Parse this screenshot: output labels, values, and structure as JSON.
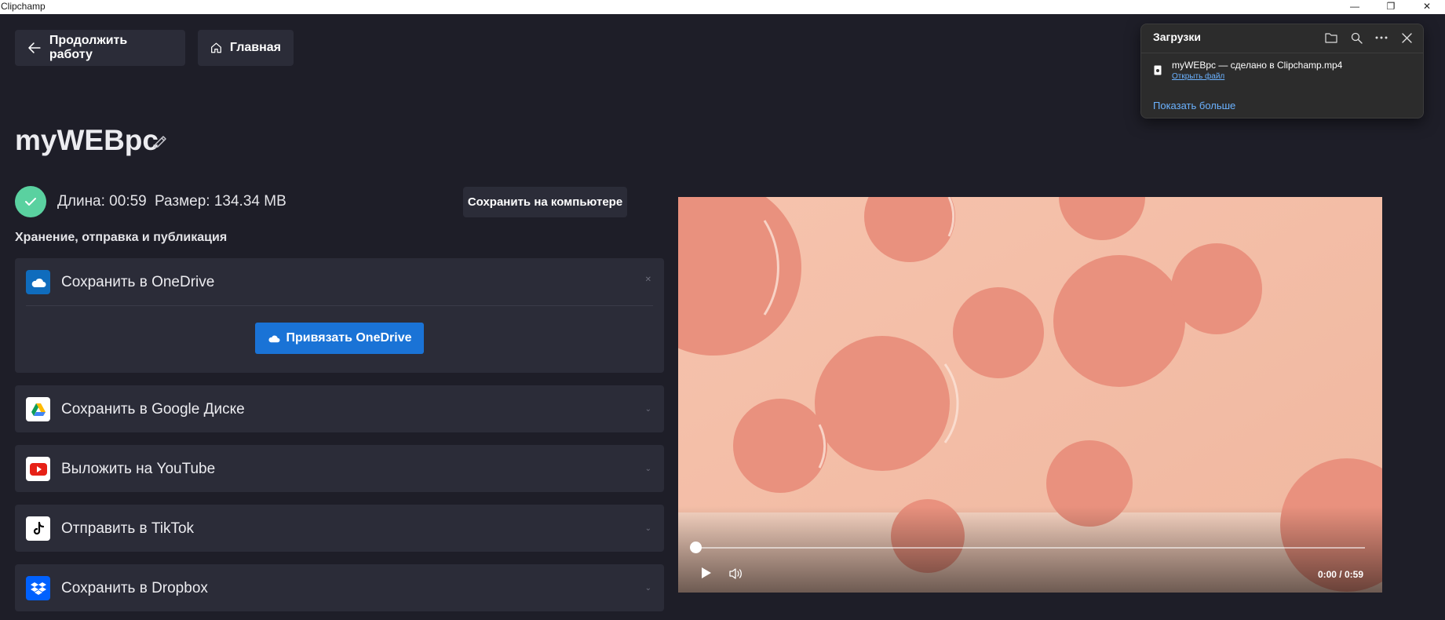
{
  "window": {
    "title": "Clipchamp",
    "controls": [
      "minimize-icon",
      "restore-icon",
      "close-icon"
    ]
  },
  "nav": {
    "back_label": "Продолжить работу",
    "home_label": "Главная"
  },
  "project": {
    "title": "myWEBpc"
  },
  "export_info": {
    "length": "Длина: 00:59",
    "size": "Размер: 134.34 MB",
    "save_pc_label": "Сохранить на компьютере"
  },
  "section": {
    "label": "Хранение, отправка и публикация"
  },
  "services": {
    "onedrive": {
      "label": "Сохранить в OneDrive",
      "link_label": "Привязать OneDrive",
      "expanded": true,
      "color": "#0f6cbd"
    },
    "gdrive": {
      "label": "Сохранить в Google Диске",
      "color": "#ffffff"
    },
    "youtube": {
      "label": "Выложить на YouTube",
      "color": "#e62117"
    },
    "tiktok": {
      "label": "Отправить в TikTok",
      "color": "#ffffff"
    },
    "dropbox": {
      "label": "Сохранить в Dropbox",
      "color": "#0061fe"
    }
  },
  "player": {
    "time": "0:00 / 0:59",
    "progress": 0.0
  },
  "downloads": {
    "title": "Загрузки",
    "file_name": "myWEBpc — сделано в Clipchamp.mp4",
    "open_label": "Открыть файл",
    "more_label": "Показать больше"
  },
  "colors": {
    "background": "#1e1e28",
    "card": "#2b2c38",
    "accent": "#1a73d6",
    "success": "#5ad1a0"
  }
}
